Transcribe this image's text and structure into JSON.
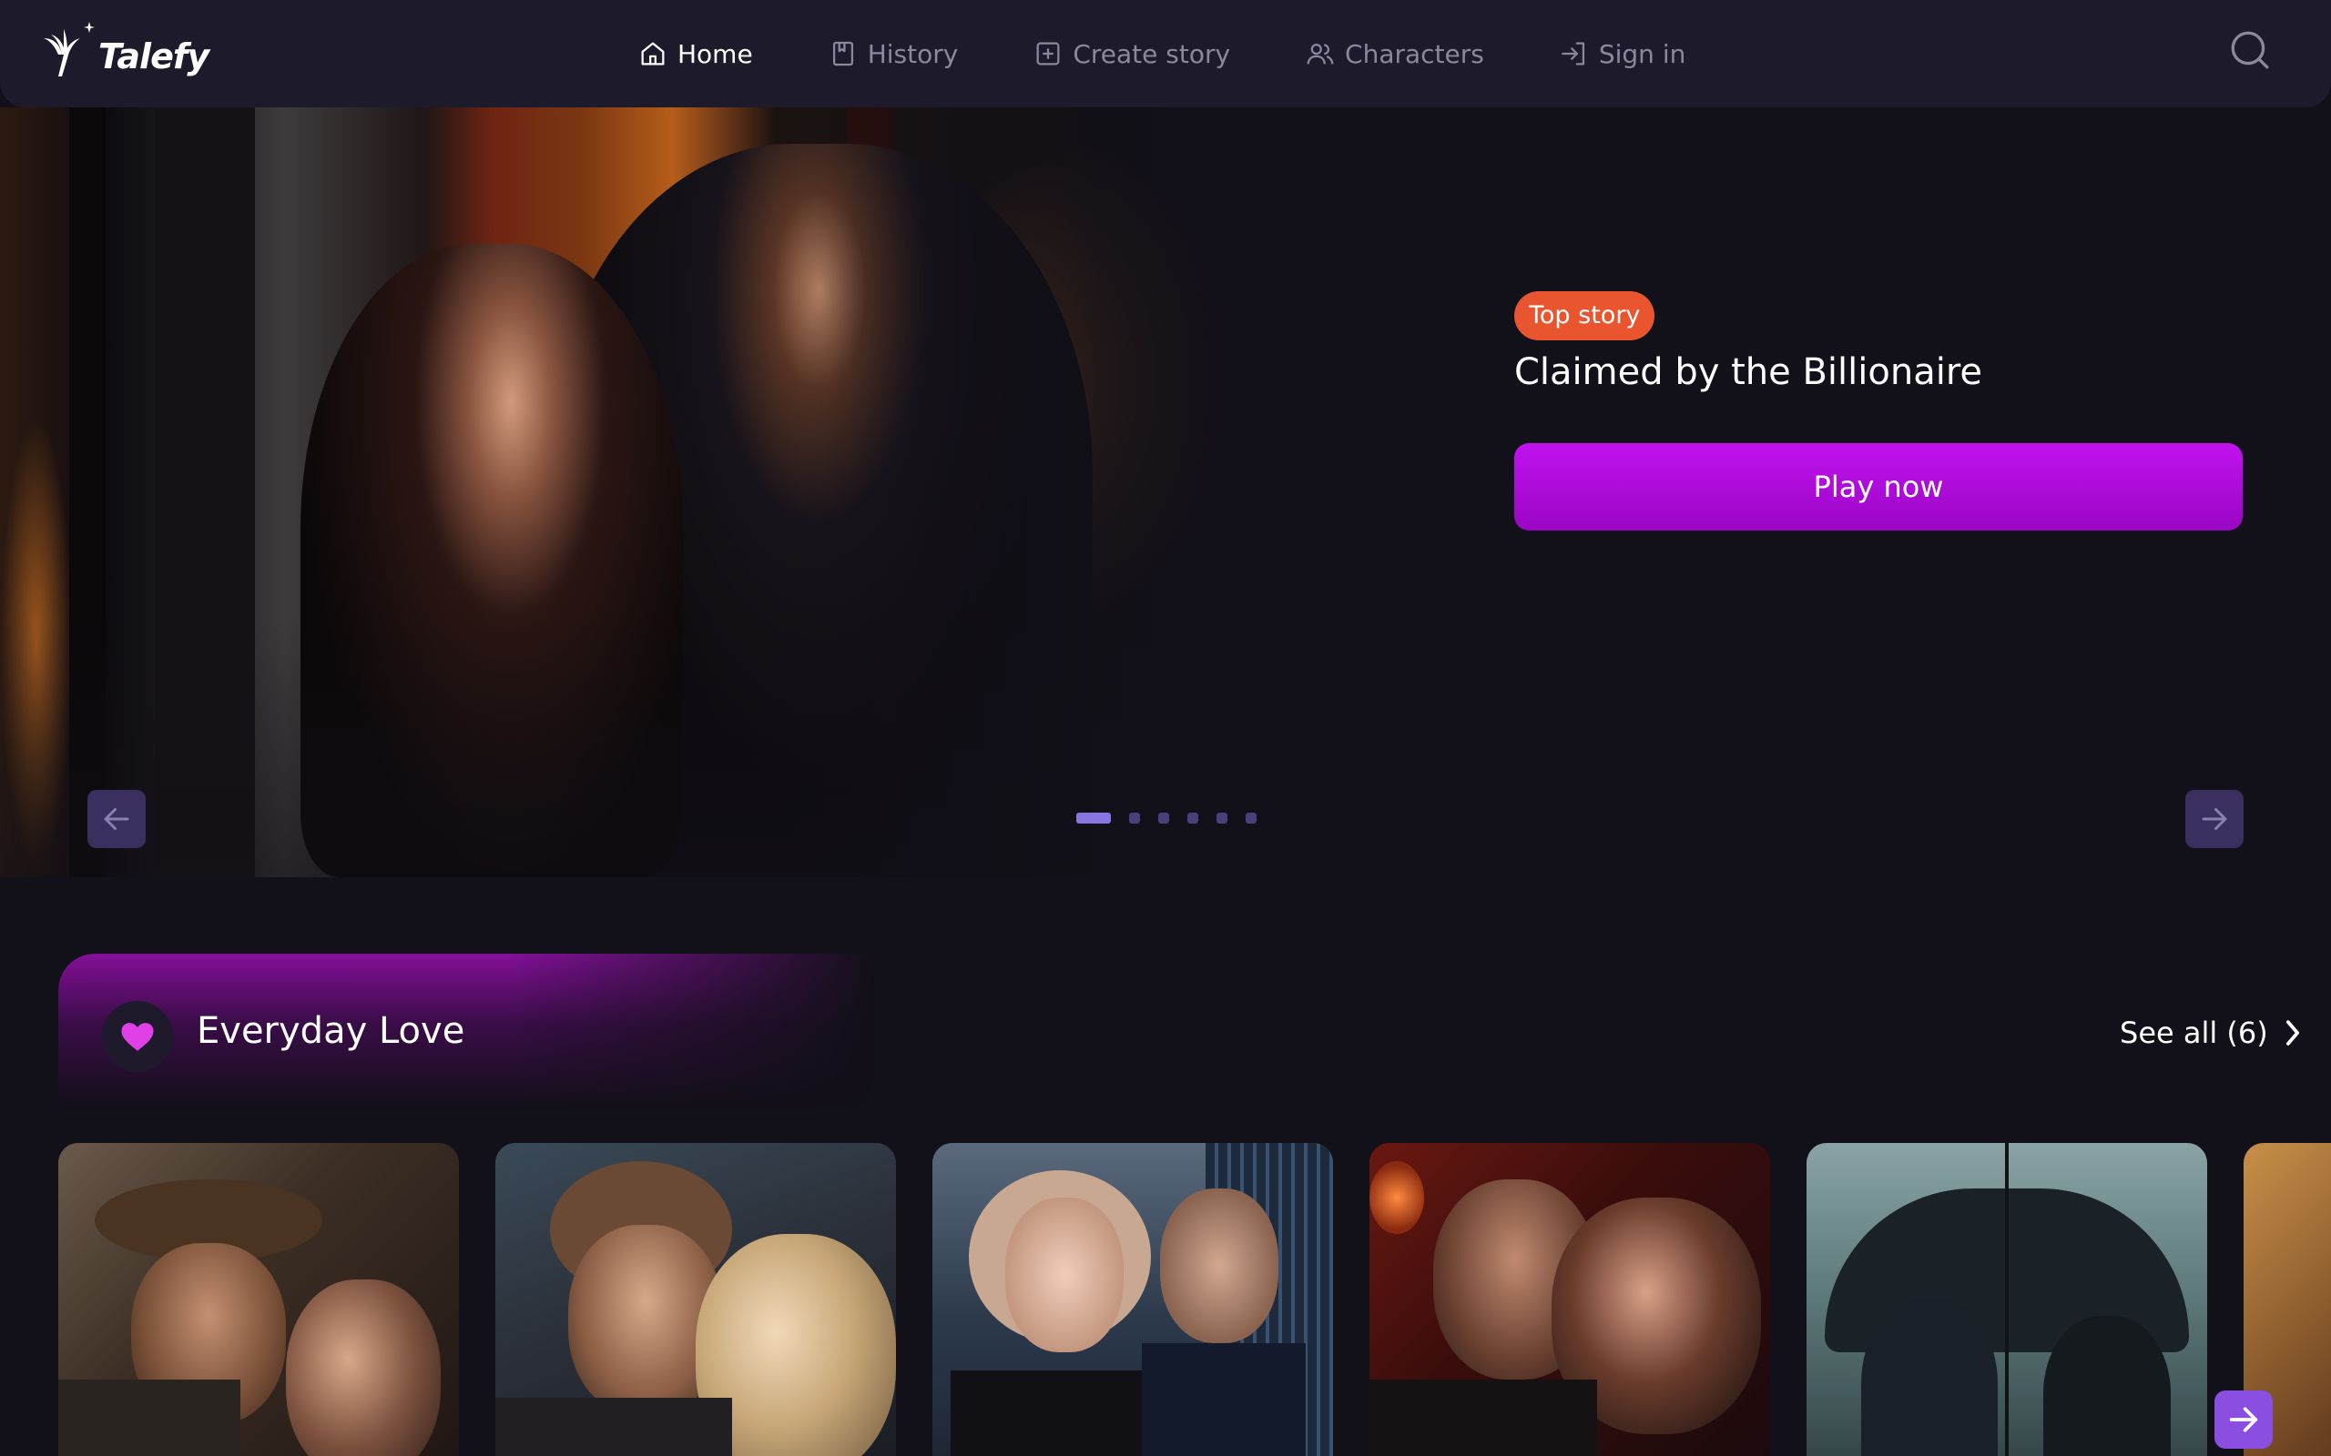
{
  "header": {
    "logo_text": "Talefy",
    "nav": [
      {
        "label": "Home",
        "icon": "home-icon",
        "active": true
      },
      {
        "label": "History",
        "icon": "bookmark-icon",
        "active": false
      },
      {
        "label": "Create story",
        "icon": "plus-square-icon",
        "active": false
      },
      {
        "label": "Characters",
        "icon": "users-icon",
        "active": false
      },
      {
        "label": "Sign in",
        "icon": "sign-in-icon",
        "active": false
      }
    ],
    "search_icon": "search-icon"
  },
  "hero": {
    "badge": "Top story",
    "title": "Claimed by the Billionaire",
    "cta": "Play now",
    "slide_count": 6,
    "active_slide": 1,
    "colors": {
      "badge": "#e8552e",
      "cta": "#b00cdc",
      "arrow_bg": "#3a2f5e",
      "dot_active": "#8a76e0"
    }
  },
  "section": {
    "icon": "heart-icon",
    "title": "Everyday Love",
    "see_all": "See all (6)",
    "accent": "#8a10a0",
    "heart_color": "#e040e8"
  },
  "cards": [
    {
      "name": "card-cowboy-couple"
    },
    {
      "name": "card-embracing-couple"
    },
    {
      "name": "card-city-couple"
    },
    {
      "name": "card-red-room-couple"
    },
    {
      "name": "card-umbrella-couple"
    },
    {
      "name": "card-partial"
    }
  ]
}
